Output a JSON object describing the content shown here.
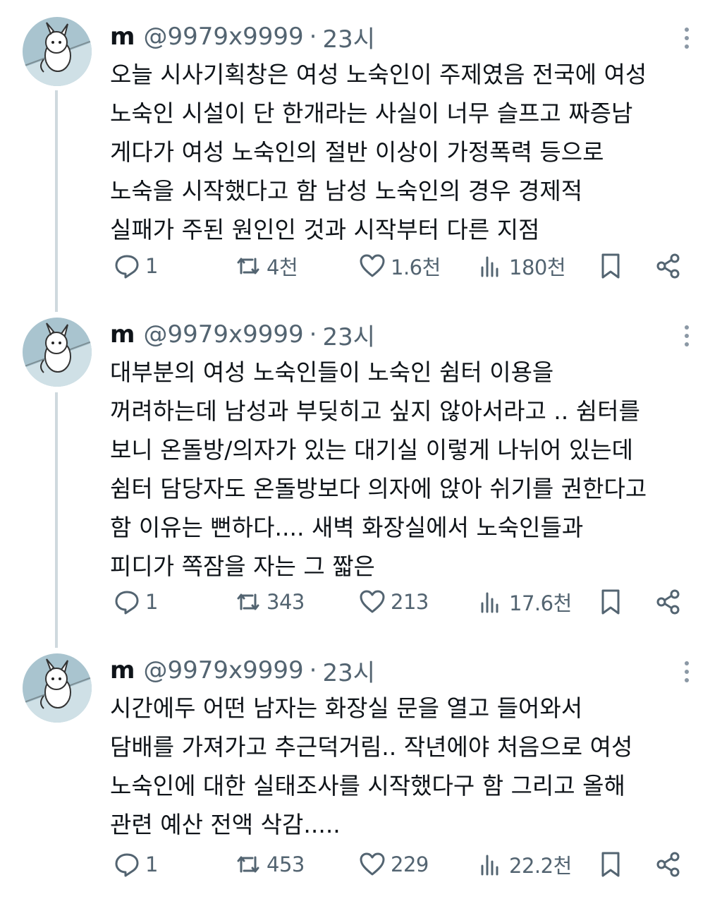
{
  "tweets": [
    {
      "name": "m",
      "handle": "@9979x9999",
      "separator": "·",
      "time": "23시",
      "lines": [
        "오늘 시사기획창은 여성 노숙인이 주제였음 전국에 여성",
        "노숙인 시설이 단 한개라는 사실이 너무 슬프고 짜증남",
        "게다가 여성 노숙인의 절반 이상이 가정폭력 등으로",
        "노숙을 시작했다고 함 남성 노숙인의 경우 경제적",
        "실패가 주된 원인인 것과 시작부터 다른 지점"
      ],
      "replies": "1",
      "retweets": "4천",
      "likes": "1.6천",
      "views": "180천"
    },
    {
      "name": "m",
      "handle": "@9979x9999",
      "separator": "·",
      "time": "23시",
      "lines": [
        "대부분의 여성 노숙인들이 노숙인 쉼터 이용을",
        "꺼려하는데 남성과 부딪히고 싶지 않아서라고 .. 쉼터를",
        "보니 온돌방/의자가 있는 대기실 이렇게 나뉘어 있는데",
        "쉼터 담당자도 온돌방보다 의자에 앉아 쉬기를 권한다고",
        "함 이유는 뻔하다.... 새벽 화장실에서 노숙인들과",
        "피디가 쪽잠을 자는 그 짧은"
      ],
      "replies": "1",
      "retweets": "343",
      "likes": "213",
      "views": "17.6천"
    },
    {
      "name": "m",
      "handle": "@9979x9999",
      "separator": "·",
      "time": "23시",
      "lines": [
        "시간에두 어떤 남자는 화장실 문을 열고 들어와서",
        "담배를 가져가고 추근덕거림.. 작년에야 처음으로 여성",
        "노숙인에 대한 실태조사를 시작했다구 함 그리고 올해",
        "관련 예산 전액 삭감....."
      ],
      "replies": "1",
      "retweets": "453",
      "likes": "229",
      "views": "22.2천"
    }
  ],
  "icons": {
    "reply": "reply-icon",
    "retweet": "retweet-icon",
    "like": "heart-icon",
    "views": "views-chart-icon",
    "bookmark": "bookmark-icon",
    "share": "share-icon",
    "more": "more-dots-icon"
  },
  "colors": {
    "text": "#0f1419",
    "secondary": "#536471",
    "thread_line": "#cfd9de"
  }
}
